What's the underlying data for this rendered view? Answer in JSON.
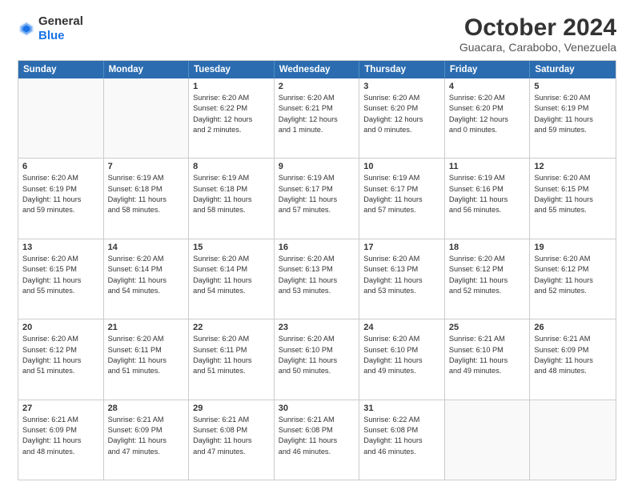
{
  "logo": {
    "general": "General",
    "blue": "Blue"
  },
  "header": {
    "title": "October 2024",
    "subtitle": "Guacara, Carabobo, Venezuela"
  },
  "weekdays": [
    "Sunday",
    "Monday",
    "Tuesday",
    "Wednesday",
    "Thursday",
    "Friday",
    "Saturday"
  ],
  "weeks": [
    [
      {
        "day": "",
        "lines": []
      },
      {
        "day": "",
        "lines": []
      },
      {
        "day": "1",
        "lines": [
          "Sunrise: 6:20 AM",
          "Sunset: 6:22 PM",
          "Daylight: 12 hours",
          "and 2 minutes."
        ]
      },
      {
        "day": "2",
        "lines": [
          "Sunrise: 6:20 AM",
          "Sunset: 6:21 PM",
          "Daylight: 12 hours",
          "and 1 minute."
        ]
      },
      {
        "day": "3",
        "lines": [
          "Sunrise: 6:20 AM",
          "Sunset: 6:20 PM",
          "Daylight: 12 hours",
          "and 0 minutes."
        ]
      },
      {
        "day": "4",
        "lines": [
          "Sunrise: 6:20 AM",
          "Sunset: 6:20 PM",
          "Daylight: 12 hours",
          "and 0 minutes."
        ]
      },
      {
        "day": "5",
        "lines": [
          "Sunrise: 6:20 AM",
          "Sunset: 6:19 PM",
          "Daylight: 11 hours",
          "and 59 minutes."
        ]
      }
    ],
    [
      {
        "day": "6",
        "lines": [
          "Sunrise: 6:20 AM",
          "Sunset: 6:19 PM",
          "Daylight: 11 hours",
          "and 59 minutes."
        ]
      },
      {
        "day": "7",
        "lines": [
          "Sunrise: 6:19 AM",
          "Sunset: 6:18 PM",
          "Daylight: 11 hours",
          "and 58 minutes."
        ]
      },
      {
        "day": "8",
        "lines": [
          "Sunrise: 6:19 AM",
          "Sunset: 6:18 PM",
          "Daylight: 11 hours",
          "and 58 minutes."
        ]
      },
      {
        "day": "9",
        "lines": [
          "Sunrise: 6:19 AM",
          "Sunset: 6:17 PM",
          "Daylight: 11 hours",
          "and 57 minutes."
        ]
      },
      {
        "day": "10",
        "lines": [
          "Sunrise: 6:19 AM",
          "Sunset: 6:17 PM",
          "Daylight: 11 hours",
          "and 57 minutes."
        ]
      },
      {
        "day": "11",
        "lines": [
          "Sunrise: 6:19 AM",
          "Sunset: 6:16 PM",
          "Daylight: 11 hours",
          "and 56 minutes."
        ]
      },
      {
        "day": "12",
        "lines": [
          "Sunrise: 6:20 AM",
          "Sunset: 6:15 PM",
          "Daylight: 11 hours",
          "and 55 minutes."
        ]
      }
    ],
    [
      {
        "day": "13",
        "lines": [
          "Sunrise: 6:20 AM",
          "Sunset: 6:15 PM",
          "Daylight: 11 hours",
          "and 55 minutes."
        ]
      },
      {
        "day": "14",
        "lines": [
          "Sunrise: 6:20 AM",
          "Sunset: 6:14 PM",
          "Daylight: 11 hours",
          "and 54 minutes."
        ]
      },
      {
        "day": "15",
        "lines": [
          "Sunrise: 6:20 AM",
          "Sunset: 6:14 PM",
          "Daylight: 11 hours",
          "and 54 minutes."
        ]
      },
      {
        "day": "16",
        "lines": [
          "Sunrise: 6:20 AM",
          "Sunset: 6:13 PM",
          "Daylight: 11 hours",
          "and 53 minutes."
        ]
      },
      {
        "day": "17",
        "lines": [
          "Sunrise: 6:20 AM",
          "Sunset: 6:13 PM",
          "Daylight: 11 hours",
          "and 53 minutes."
        ]
      },
      {
        "day": "18",
        "lines": [
          "Sunrise: 6:20 AM",
          "Sunset: 6:12 PM",
          "Daylight: 11 hours",
          "and 52 minutes."
        ]
      },
      {
        "day": "19",
        "lines": [
          "Sunrise: 6:20 AM",
          "Sunset: 6:12 PM",
          "Daylight: 11 hours",
          "and 52 minutes."
        ]
      }
    ],
    [
      {
        "day": "20",
        "lines": [
          "Sunrise: 6:20 AM",
          "Sunset: 6:12 PM",
          "Daylight: 11 hours",
          "and 51 minutes."
        ]
      },
      {
        "day": "21",
        "lines": [
          "Sunrise: 6:20 AM",
          "Sunset: 6:11 PM",
          "Daylight: 11 hours",
          "and 51 minutes."
        ]
      },
      {
        "day": "22",
        "lines": [
          "Sunrise: 6:20 AM",
          "Sunset: 6:11 PM",
          "Daylight: 11 hours",
          "and 51 minutes."
        ]
      },
      {
        "day": "23",
        "lines": [
          "Sunrise: 6:20 AM",
          "Sunset: 6:10 PM",
          "Daylight: 11 hours",
          "and 50 minutes."
        ]
      },
      {
        "day": "24",
        "lines": [
          "Sunrise: 6:20 AM",
          "Sunset: 6:10 PM",
          "Daylight: 11 hours",
          "and 49 minutes."
        ]
      },
      {
        "day": "25",
        "lines": [
          "Sunrise: 6:21 AM",
          "Sunset: 6:10 PM",
          "Daylight: 11 hours",
          "and 49 minutes."
        ]
      },
      {
        "day": "26",
        "lines": [
          "Sunrise: 6:21 AM",
          "Sunset: 6:09 PM",
          "Daylight: 11 hours",
          "and 48 minutes."
        ]
      }
    ],
    [
      {
        "day": "27",
        "lines": [
          "Sunrise: 6:21 AM",
          "Sunset: 6:09 PM",
          "Daylight: 11 hours",
          "and 48 minutes."
        ]
      },
      {
        "day": "28",
        "lines": [
          "Sunrise: 6:21 AM",
          "Sunset: 6:09 PM",
          "Daylight: 11 hours",
          "and 47 minutes."
        ]
      },
      {
        "day": "29",
        "lines": [
          "Sunrise: 6:21 AM",
          "Sunset: 6:08 PM",
          "Daylight: 11 hours",
          "and 47 minutes."
        ]
      },
      {
        "day": "30",
        "lines": [
          "Sunrise: 6:21 AM",
          "Sunset: 6:08 PM",
          "Daylight: 11 hours",
          "and 46 minutes."
        ]
      },
      {
        "day": "31",
        "lines": [
          "Sunrise: 6:22 AM",
          "Sunset: 6:08 PM",
          "Daylight: 11 hours",
          "and 46 minutes."
        ]
      },
      {
        "day": "",
        "lines": []
      },
      {
        "day": "",
        "lines": []
      }
    ]
  ]
}
